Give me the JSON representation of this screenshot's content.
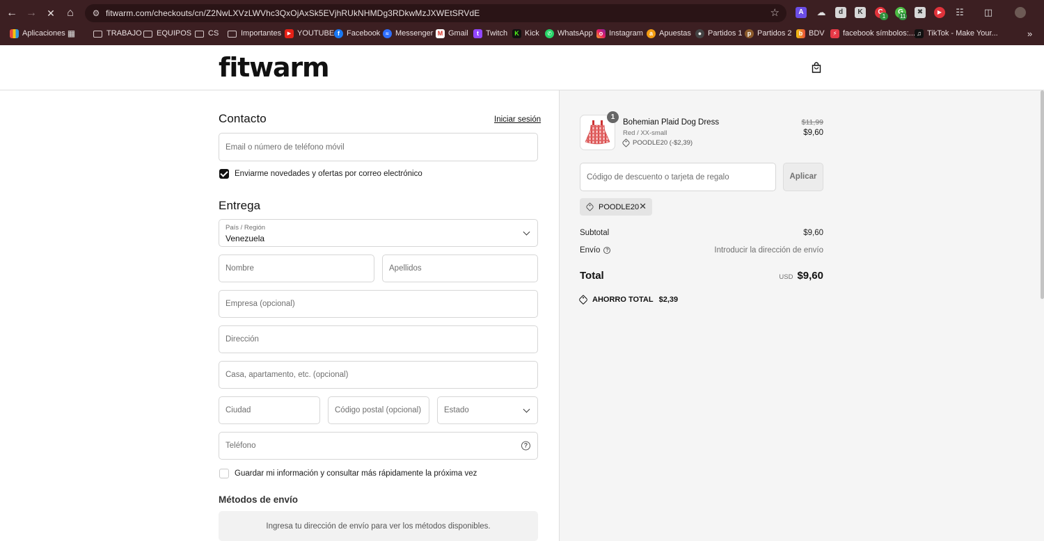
{
  "browser": {
    "url": "fitwarm.com/checkouts/cn/Z2NwLXVzLWVhc3QxOjAxSk5EVjhRUkNHMDg3RDkwMzJXWEtSRVdE",
    "extension_badges": {
      "ext4": "1",
      "ext5": "11"
    },
    "bookmarks": [
      {
        "label": "Aplicaciones",
        "icon": "apps-grid-icon"
      },
      {
        "label": "TRABAJO",
        "icon": "folder-icon"
      },
      {
        "label": "EQUIPOS",
        "icon": "folder-icon"
      },
      {
        "label": "CS",
        "icon": "folder-icon"
      },
      {
        "label": "Importantes",
        "icon": "folder-icon"
      },
      {
        "label": "YOUTUBE",
        "icon": "youtube-icon"
      },
      {
        "label": "Facebook",
        "icon": "facebook-icon"
      },
      {
        "label": "Messenger",
        "icon": "messenger-icon"
      },
      {
        "label": "Gmail",
        "icon": "gmail-icon"
      },
      {
        "label": "Twitch",
        "icon": "twitch-icon"
      },
      {
        "label": "Kick",
        "icon": "kick-icon"
      },
      {
        "label": "WhatsApp",
        "icon": "whatsapp-icon"
      },
      {
        "label": "Instagram",
        "icon": "instagram-icon"
      },
      {
        "label": "Apuestas",
        "icon": "apuestas-icon"
      },
      {
        "label": "Partidos 1",
        "icon": "soccer-icon"
      },
      {
        "label": "Partidos 2",
        "icon": "partidos-icon"
      },
      {
        "label": "BDV",
        "icon": "bdv-icon"
      },
      {
        "label": "facebook símbolos:...",
        "icon": "bolt-icon"
      },
      {
        "label": "TikTok - Make Your...",
        "icon": "tiktok-icon"
      }
    ]
  },
  "store": {
    "logo": "fitwarm"
  },
  "contact": {
    "title": "Contacto",
    "login_link": "Iniciar sesión",
    "email_placeholder": "Email o número de teléfono móvil",
    "newsletter_label": "Enviarme novedades y ofertas por correo electrónico",
    "newsletter_checked": true
  },
  "delivery": {
    "title": "Entrega",
    "country_label": "País / Región",
    "country_value": "Venezuela",
    "first_name_placeholder": "Nombre",
    "last_name_placeholder": "Apellidos",
    "company_placeholder": "Empresa (opcional)",
    "address_placeholder": "Dirección",
    "apartment_placeholder": "Casa, apartamento, etc. (opcional)",
    "city_placeholder": "Ciudad",
    "postal_placeholder": "Código postal (opcional)",
    "state_placeholder": "Estado",
    "phone_placeholder": "Teléfono",
    "save_info_label": "Guardar mi información y consultar más rápidamente la próxima vez",
    "save_info_checked": false
  },
  "shipping_methods": {
    "title": "Métodos de envío",
    "message": "Ingresa tu dirección de envío para ver los métodos disponibles."
  },
  "summary": {
    "item": {
      "quantity": "1",
      "name": "Bohemian Plaid Dog Dress",
      "variant": "Red / XX-small",
      "discount": "POODLE20 (-$2,39)",
      "original_price": "$11,99",
      "price": "$9,60"
    },
    "discount_placeholder": "Código de descuento o tarjeta de regalo",
    "apply_label": "Aplicar",
    "applied_code": "POODLE20",
    "subtotal_label": "Subtotal",
    "subtotal_value": "$9,60",
    "shipping_label": "Envío",
    "shipping_value": "Introducir la dirección de envío",
    "total_label": "Total",
    "total_currency": "USD",
    "total_value": "$9,60",
    "savings_label": "AHORRO TOTAL",
    "savings_value": "$2,39"
  },
  "colors": {
    "browser_chrome": "#3c1f22",
    "summary_bg": "#f5f5f5",
    "primary_text": "#111111"
  }
}
